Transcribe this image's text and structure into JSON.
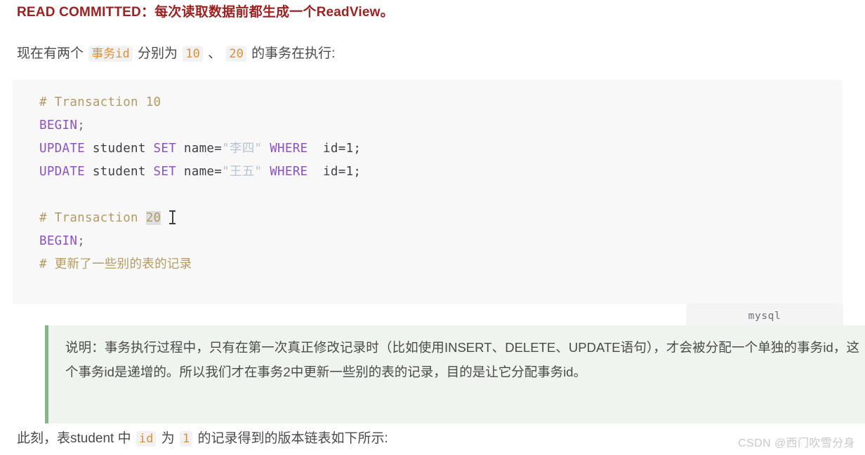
{
  "heading": {
    "isolation_level": "READ COMMITTED",
    "separator": "：",
    "description": "每次读取数据前都生成一个ReadView。"
  },
  "intro": {
    "before_code": "现在有两个 ",
    "code_1": "事务id",
    "mid_1": " 分别为 ",
    "code_2": "10",
    "mid_2": " 、 ",
    "code_3": "20",
    "after_code": " 的事务在执行:"
  },
  "code_block": {
    "language_label": "mysql",
    "lines": [
      {
        "id": "line-1",
        "tokens": [
          {
            "type": "comment",
            "text": "# Transaction 10"
          }
        ]
      },
      {
        "id": "line-2",
        "tokens": [
          {
            "type": "kw",
            "text": "BEGIN"
          },
          {
            "type": "punct",
            "text": ";"
          }
        ]
      },
      {
        "id": "line-3",
        "tokens": [
          {
            "type": "kw",
            "text": "UPDATE"
          },
          {
            "type": "plain",
            "text": " student "
          },
          {
            "type": "kw",
            "text": "SET"
          },
          {
            "type": "plain",
            "text": " name="
          },
          {
            "type": "str",
            "text": "\"李四\""
          },
          {
            "type": "plain",
            "text": " "
          },
          {
            "type": "kw",
            "text": "WHERE"
          },
          {
            "type": "plain",
            "text": "  id=1;"
          }
        ]
      },
      {
        "id": "line-4",
        "tokens": [
          {
            "type": "kw",
            "text": "UPDATE"
          },
          {
            "type": "plain",
            "text": " student "
          },
          {
            "type": "kw",
            "text": "SET"
          },
          {
            "type": "plain",
            "text": " name="
          },
          {
            "type": "str",
            "text": "\"王五\""
          },
          {
            "type": "plain",
            "text": " "
          },
          {
            "type": "kw",
            "text": "WHERE"
          },
          {
            "type": "plain",
            "text": "  id=1;"
          }
        ]
      },
      {
        "id": "line-5",
        "tokens": []
      },
      {
        "id": "line-6",
        "tokens": [
          {
            "type": "comment",
            "text": "# Transaction "
          },
          {
            "type": "comment-selected",
            "text": "20"
          }
        ],
        "caret": true
      },
      {
        "id": "line-7",
        "tokens": [
          {
            "type": "kw",
            "text": "BEGIN"
          },
          {
            "type": "punct",
            "text": ";"
          }
        ]
      },
      {
        "id": "line-8",
        "tokens": [
          {
            "type": "comment",
            "text": "# 更新了一些别的表的记录"
          }
        ]
      },
      {
        "id": "line-9",
        "tokens": []
      },
      {
        "id": "line-10",
        "tokens": [
          {
            "type": "dots",
            "text": "..."
          }
        ]
      }
    ]
  },
  "note": {
    "text": "说明：事务执行过程中，只有在第一次真正修改记录时（比如使用INSERT、DELETE、UPDATE语句），才会被分配一个单独的事务id，这个事务id是递增的。所以我们才在事务2中更新一些别的表的记录，目的是让它分配事务id。"
  },
  "closing": {
    "part_1": "此刻，表student 中 ",
    "code_1": "id",
    "part_2": " 为 ",
    "code_2": "1",
    "part_3": " 的记录得到的版本链表如下所示:"
  },
  "watermark": {
    "text": "CSDN @西门吹雪分身"
  },
  "colors": {
    "heading": "#9c2221",
    "body_text": "#4a4a4a",
    "inline_code": "#d9903c",
    "inline_code_bg": "#f2f2f2",
    "code_bg": "#f8f8f9",
    "keyword": "#8c52c4",
    "comment": "#b39b63",
    "string": "#b9c2d0",
    "note_bg": "#eff4ef",
    "note_border": "#8ab58a",
    "watermark": "#c9c9c9"
  }
}
